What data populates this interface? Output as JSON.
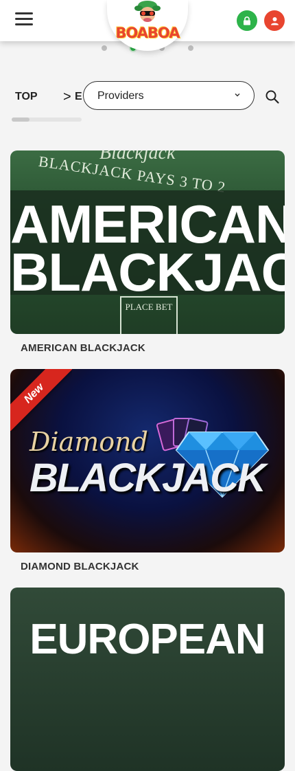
{
  "header": {
    "logo_text": "BOABOA",
    "menu_icon": "hamburger-menu-icon",
    "lock_icon": "lock-icon",
    "user_icon": "user-icon",
    "colors": {
      "green": "#2db34a",
      "red": "#e8452f"
    }
  },
  "carousel": {
    "dot_count": 4,
    "active_index": 1
  },
  "nav": {
    "top_label": "TOP",
    "arrow": ">",
    "next_label": "E",
    "providers_label": "Providers",
    "search_icon": "search-icon"
  },
  "games": [
    {
      "title": "AMERICAN BLACKJACK",
      "art_line1": "AMERICAN",
      "art_line2": "BLACKJACK",
      "table_text": "BLACKJACK PAYS 3 TO 2",
      "table_top_text": "Blackjack",
      "place_bet": "PLACE BET"
    },
    {
      "title": "DIAMOND BLACKJACK",
      "badge": "New",
      "art_line1": "Diamond",
      "art_line2": "BLACKJACK"
    },
    {
      "title": "",
      "art_line1": "EUROPEAN"
    }
  ]
}
